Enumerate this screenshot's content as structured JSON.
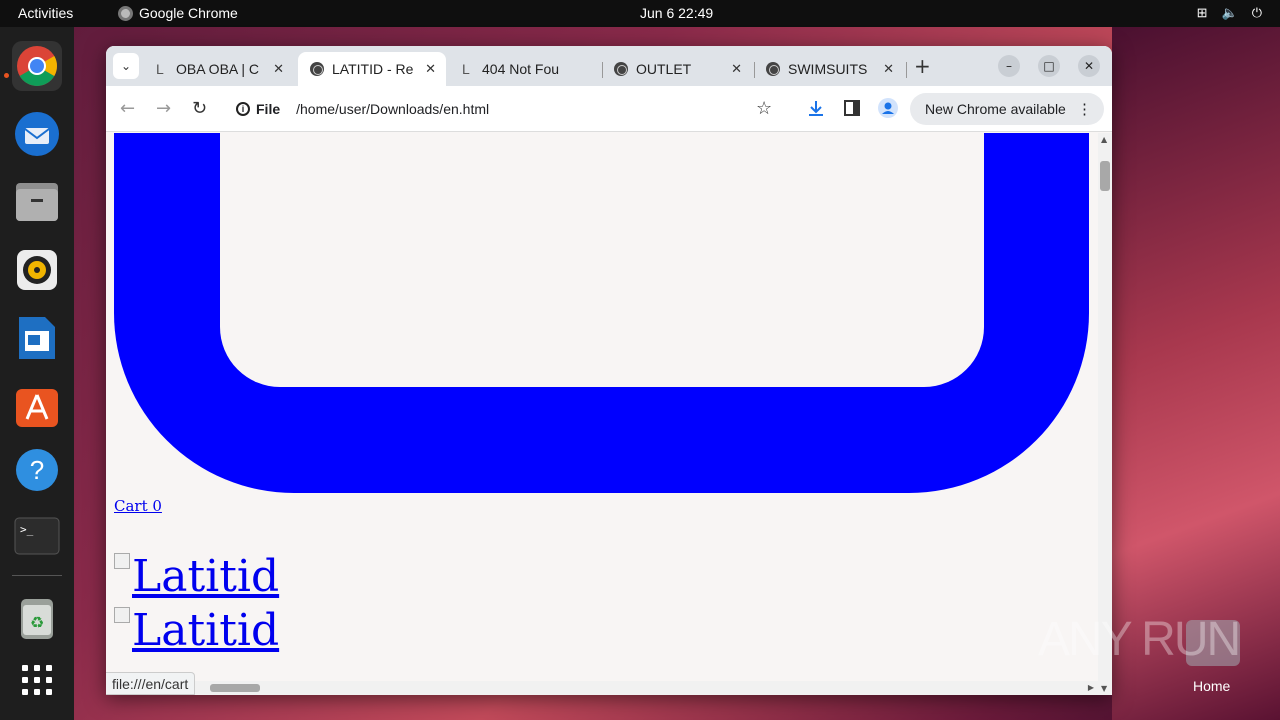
{
  "topbar": {
    "activities": "Activities",
    "app_name": "Google Chrome",
    "clock": "Jun 6  22:49"
  },
  "dock": {
    "items": [
      "chrome",
      "thunderbird",
      "files",
      "rhythmbox",
      "libreoffice-writer",
      "app-center",
      "help",
      "terminal",
      "trash",
      "show-apps"
    ]
  },
  "browser": {
    "tabs": [
      {
        "title": "OBA OBA | C",
        "icon": "loading-L-icon",
        "active": false
      },
      {
        "title": "LATITID - Re",
        "icon": "globe-icon",
        "active": true
      },
      {
        "title": "404 Not Fou",
        "icon": "loading-L-icon",
        "active": false
      },
      {
        "title": "OUTLET",
        "icon": "globe-icon",
        "active": false
      },
      {
        "title": "SWIMSUITS",
        "icon": "globe-icon",
        "active": false
      }
    ],
    "site_info_label": "File",
    "url": "/home/user/Downloads/en.html",
    "update_button": "New Chrome available",
    "status_url": "file:///en/cart"
  },
  "page": {
    "cart_link": "Cart 0",
    "logo_alt_1": "Latitid",
    "logo_alt_2": "Latitid",
    "colors": {
      "shape": "#0000ff",
      "background": "#f8f5f4",
      "link": "#0000ee"
    }
  },
  "desktop": {
    "watermark": "ANY RUN",
    "home_label": "Home"
  }
}
